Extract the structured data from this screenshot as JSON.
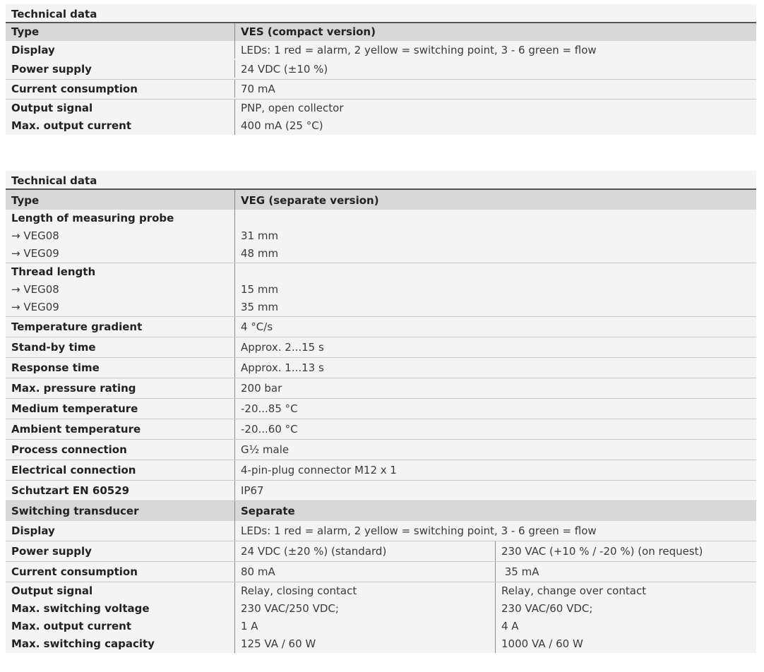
{
  "table1": {
    "title": "Technical data",
    "header": {
      "label": "Type",
      "value": "VES (compact version)"
    },
    "rows": [
      {
        "label": "Display",
        "value": "LEDs: 1 red = alarm, 2 yellow = switching point, 3 - 6 green = flow"
      },
      {
        "label": "Power supply",
        "value": "24 VDC (±10 %)"
      },
      {
        "label": "Current consumption",
        "value": "70 mA"
      },
      {
        "label1": "Output signal",
        "label2": "Max. output current",
        "value1": "PNP, open collector",
        "value2": "400 mA (25 °C)"
      }
    ]
  },
  "table2": {
    "title": "Technical data",
    "header": {
      "label": "Type",
      "value": "VEG (separate version)"
    },
    "probe": {
      "label": "Length of measuring probe",
      "sub1": "→ VEG08",
      "sub2": "→ VEG09",
      "v1": "31 mm",
      "v2": "48 mm"
    },
    "thread": {
      "label": "Thread length",
      "sub1": "→ VEG08",
      "sub2": "→ VEG09",
      "v1": "15 mm",
      "v2": "35 mm"
    },
    "rows": [
      {
        "label": "Temperature gradient",
        "value": "4 °C/s"
      },
      {
        "label": "Stand-by time",
        "value": "Approx. 2...15 s"
      },
      {
        "label": "Response time",
        "value": "Approx. 1...13 s"
      },
      {
        "label": "Max. pressure rating",
        "value": "200 bar"
      },
      {
        "label": "Medium temperature",
        "value": "-20...85 °C"
      },
      {
        "label": "Ambient temperature",
        "value": "-20...60 °C"
      },
      {
        "label": "Process connection",
        "value": "G½ male"
      },
      {
        "label": "Electrical connection",
        "value": "4-pin-plug connector M12 x 1"
      },
      {
        "label": "Schutzart EN 60529",
        "value": "IP67"
      }
    ],
    "transducer": {
      "label": "Switching transducer",
      "value": "Separate"
    },
    "display": {
      "label": "Display",
      "value": "LEDs: 1 red = alarm, 2 yellow = switching point, 3 - 6 green = flow"
    },
    "power": {
      "label": "Power supply",
      "a": "24 VDC (±20 %) (standard)",
      "b": "230 VAC (+10 % / -20 %) (on request)"
    },
    "current": {
      "label": "Current consumption",
      "a": "80 mA",
      "b": " 35 mA"
    },
    "output": {
      "labels": [
        "Output signal",
        "Max. switching voltage",
        "Max. output current",
        "Max. switching capacity"
      ],
      "a": [
        "Relay, closing contact",
        "230 VAC/250 VDC;",
        "1 A",
        "125 VA / 60 W"
      ],
      "b": [
        "Relay, change over contact",
        "230 VAC/60 VDC;",
        "4 A",
        "1000 VA / 60 W"
      ]
    }
  }
}
